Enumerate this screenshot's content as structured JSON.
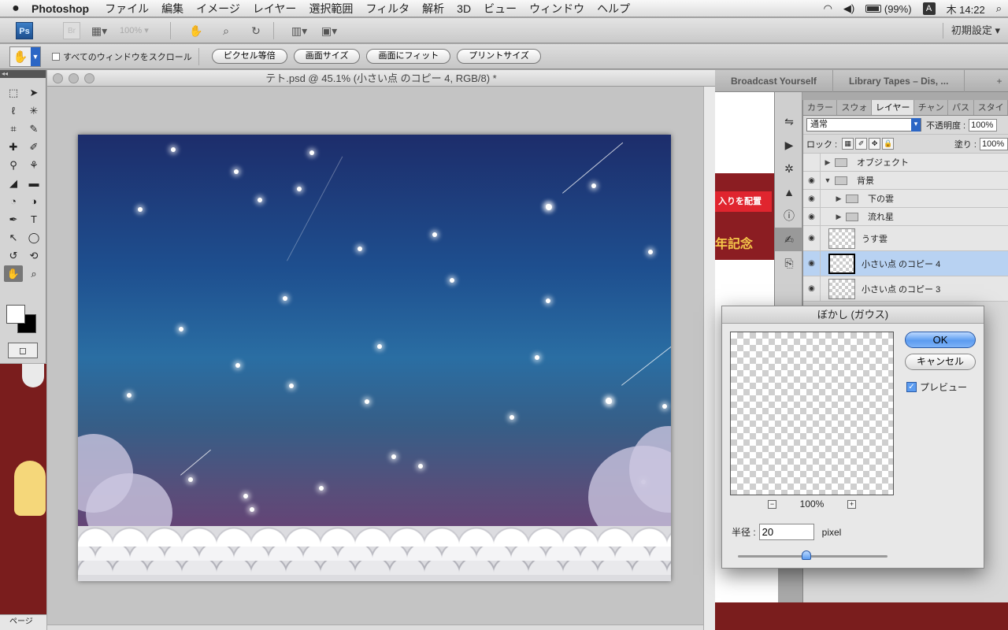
{
  "menubar": {
    "app_name": "Photoshop",
    "items": [
      "ファイル",
      "編集",
      "イメージ",
      "レイヤー",
      "選択範囲",
      "フィルタ",
      "解析",
      "3D",
      "ビュー",
      "ウィンドウ",
      "ヘルプ"
    ],
    "battery": "(99%)",
    "input_method": "A",
    "clock": "木 14:22"
  },
  "appbar": {
    "ps_label": "Ps",
    "br_label": "Br",
    "zoom": "100%",
    "workspace": "初期設定"
  },
  "options": {
    "scroll_all_label": "すべてのウィンドウをスクロール",
    "buttons": [
      "ピクセル等倍",
      "画面サイズ",
      "画面にフィット",
      "プリントサイズ"
    ]
  },
  "document": {
    "title": "テト.psd @ 45.1% (小さい点 のコピー 4, RGB/8) *"
  },
  "left_strip": {
    "page_info": "ページを..."
  },
  "browser": {
    "tabs": [
      "Broadcast Yourself",
      "Library Tapes – Dis, ..."
    ],
    "banner_text": "入りを配置",
    "gold_text": "年記念"
  },
  "layers_panel": {
    "tabs": [
      "カラー",
      "スウォ",
      "レイヤー",
      "チャン",
      "パス",
      "スタイ"
    ],
    "blend_mode": "通常",
    "opacity_label": "不透明度 :",
    "opacity": "100%",
    "lock_label": "ロック :",
    "fill_label": "塗り :",
    "fill": "100%",
    "layers": [
      {
        "name": "オブジェクト",
        "kind": "group"
      },
      {
        "name": "背景",
        "kind": "group-open"
      },
      {
        "name": "下の雲",
        "kind": "subgroup"
      },
      {
        "name": "流れ星",
        "kind": "subgroup"
      },
      {
        "name": "うす雲",
        "kind": "layer"
      },
      {
        "name": "小さい点 のコピー 4",
        "kind": "layer",
        "selected": true
      },
      {
        "name": "小さい点 のコピー 3",
        "kind": "layer"
      }
    ]
  },
  "dialog": {
    "title": "ぼかし (ガウス)",
    "ok": "OK",
    "cancel": "キャンセル",
    "preview_label": "プレビュー",
    "zoom": "100%",
    "radius_label": "半径 :",
    "radius_value": "20",
    "unit": "pixel",
    "slider_level": 0.46
  }
}
